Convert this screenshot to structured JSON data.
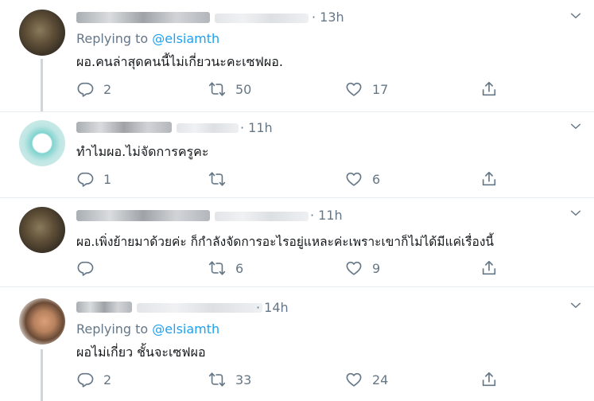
{
  "tweets": [
    {
      "time": "· 13h",
      "replying_label": "Replying to",
      "replying_handle": "@elsiamth",
      "text": "ผอ.คนล่าสุดคนนี้ไม่เกี่ยวนะคะเซฟผอ.",
      "replies": "2",
      "retweets": "50",
      "likes": "17"
    },
    {
      "time": "· 11h",
      "text": "ทำไมผอ.ไม่จัดการครูคะ",
      "replies": "1",
      "retweets": "",
      "likes": "6"
    },
    {
      "time": "· 11h",
      "text": "ผอ.เพิ่งย้ายมาด้วยค่ะ ก็กำลังจัดการอะไรอยู่แหละค่ะเพราะเขาก็ไม่ได้มีแค่เรื่องนี้",
      "replies": "",
      "retweets": "6",
      "likes": "9"
    },
    {
      "time": "· 14h",
      "replying_label": "Replying to",
      "replying_handle": "@elsiamth",
      "text": "ผอไม่เกี่ยว ชั้นจะเซฟผอ",
      "replies": "2",
      "retweets": "33",
      "likes": "24"
    }
  ],
  "icons": {
    "reply": "reply-icon",
    "retweet": "retweet-icon",
    "like": "like-icon",
    "share": "share-icon",
    "more": "chevron-down-icon"
  },
  "colors": {
    "mention": "#1da1f2",
    "meta": "#657786",
    "divider": "#e6ecf0"
  }
}
